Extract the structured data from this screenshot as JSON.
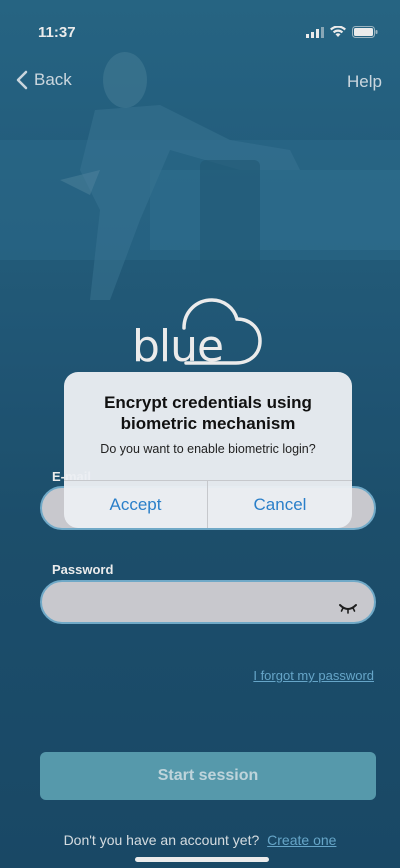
{
  "status_bar": {
    "time": "11:37",
    "icons": [
      "signal-icon",
      "wifi-icon",
      "battery-icon"
    ]
  },
  "nav": {
    "back_label": "Back",
    "help_label": "Help"
  },
  "logo_text": "blue",
  "form": {
    "email_label": "E-mail",
    "email_value": "",
    "password_label": "Password",
    "password_value": "",
    "forgot_password": "I forgot my password",
    "start_session": "Start session",
    "signup_question": "Don't you have an account yet?",
    "signup_link": "Create one"
  },
  "alert": {
    "title": "Encrypt credentials using biometric mechanism",
    "message": "Do you want to enable biometric login?",
    "accept_label": "Accept",
    "cancel_label": "Cancel"
  },
  "colors": {
    "background": "#256283",
    "link": "#6fb4da",
    "button": "#5ea7ba",
    "alert_button_text": "#2a7fc9"
  }
}
